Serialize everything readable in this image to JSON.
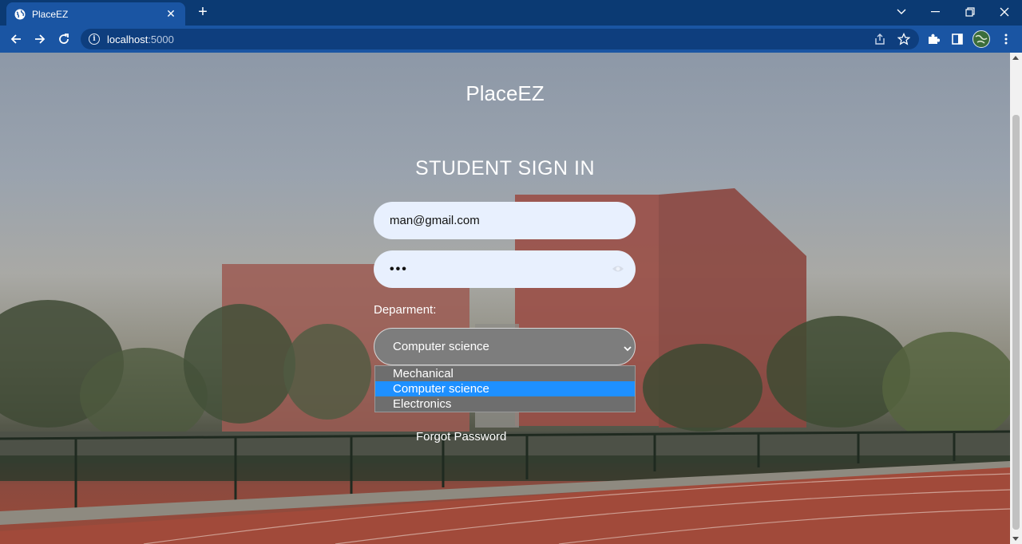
{
  "browser": {
    "tab_title": "PlaceEZ",
    "url_host": "localhost",
    "url_port": ":5000"
  },
  "page": {
    "brand": "PlaceEZ",
    "heading": "STUDENT SIGN IN",
    "email_value": "man@gmail.com",
    "password_mask": "•••",
    "department_label": "Deparment:",
    "department_selected": "Computer science",
    "department_options": [
      "Mechanical",
      "Computer science",
      "Electronics"
    ],
    "forgot_password": "Forgot Password"
  },
  "colors": {
    "browser_frame": "#0b3a73",
    "browser_toolbar": "#1a55a3",
    "input_background": "#e8f0fe",
    "select_background": "#7d7d7d",
    "option_highlight": "#1e90ff"
  },
  "icons": {
    "favicon": "globe-icon",
    "back": "arrow-left-icon",
    "forward": "arrow-right-icon",
    "reload": "reload-icon",
    "info": "info-icon",
    "share": "share-icon",
    "bookmark": "star-icon",
    "extensions": "puzzle-icon",
    "side_panel": "side-panel-icon",
    "profile": "avatar",
    "menu": "kebab-menu-icon",
    "password_toggle": "eye-icon"
  }
}
